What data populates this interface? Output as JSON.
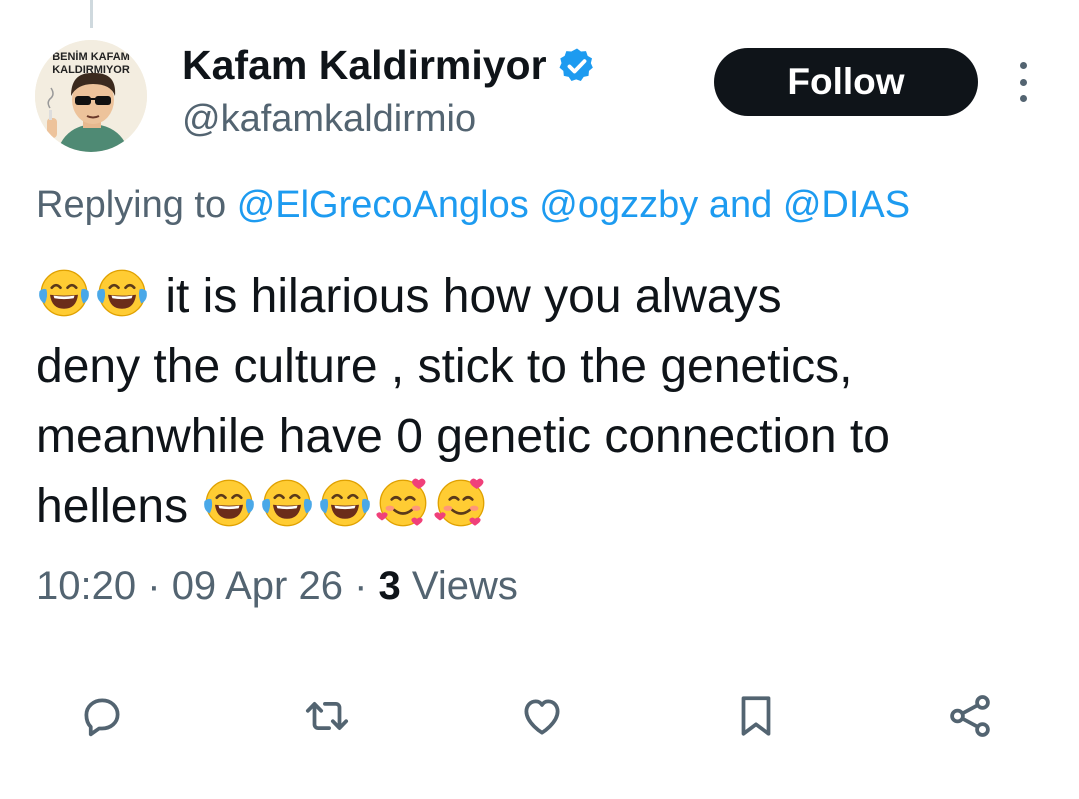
{
  "author": {
    "avatar_caption_line1": "BENİM KAFAM",
    "avatar_caption_line2": "KALDIRMIYOR",
    "display_name": "Kafam Kaldirmiyor",
    "handle": "@kafamkaldirmio",
    "verified": true,
    "verified_color": "#1d9bf0"
  },
  "follow_button": {
    "label": "Follow"
  },
  "reply_context": {
    "prefix": "Replying to",
    "mention1": "@ElGrecoAnglos",
    "mention2": "@ogzzby",
    "conjunction": "and",
    "mention3": "@DIAS"
  },
  "tweet": {
    "line1": "it is hilarious how you always",
    "line2": "deny the culture , stick to the genetics,",
    "line3": "meanwhile have 0 genetic connection to",
    "line4": "hellens",
    "emojis_start": [
      "face-with-tears-of-joy",
      "face-with-tears-of-joy"
    ],
    "emojis_end": [
      "face-with-tears-of-joy",
      "face-with-tears-of-joy",
      "face-with-tears-of-joy",
      "smiling-face-with-hearts",
      "smiling-face-with-hearts"
    ]
  },
  "meta": {
    "time": "10:20",
    "separator": "·",
    "date": "09 Apr 26",
    "views_count": "3",
    "views_label": "Views"
  },
  "actions": [
    "reply-icon",
    "retweet-icon",
    "like-icon",
    "bookmark-icon",
    "share-icon"
  ],
  "colors": {
    "accent": "#1d9bf0",
    "text": "#0f1419",
    "secondary": "#536471"
  }
}
